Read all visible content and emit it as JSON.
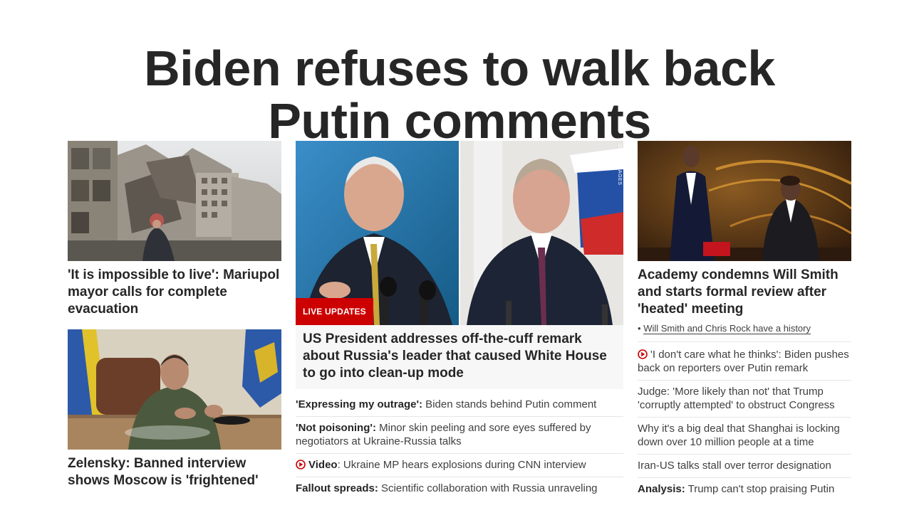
{
  "headline": {
    "line1": "Biden refuses to walk back",
    "line2": "Putin comments"
  },
  "left": {
    "story1": {
      "title": "'It is impossible to live': Mariupol mayor calls for complete evacuation"
    },
    "story2": {
      "title": "Zelensky: Banned interview shows Moscow is 'frightened'"
    }
  },
  "center": {
    "badge": "LIVE UPDATES",
    "credit": "GETTY IMAGES",
    "title": "US President addresses off-the-cuff remark about Russia's leader that caused White House to go into clean-up mode",
    "links": [
      {
        "lead": "'Expressing my outrage':",
        "text": " Biden stands behind Putin comment",
        "icon": ""
      },
      {
        "lead": "'Not poisoning':",
        "text": " Minor skin peeling and sore eyes suffered by negotiators at Ukraine-Russia talks",
        "icon": ""
      },
      {
        "lead": "Video",
        "text": ": Ukraine MP hears explosions during CNN interview",
        "icon": "play-icon"
      },
      {
        "lead": "Fallout spreads:",
        "text": " Scientific collaboration with Russia unraveling",
        "icon": ""
      }
    ]
  },
  "right": {
    "title": "Academy condemns Will Smith and starts formal review after 'heated' meeting",
    "bullet_prefix": "•",
    "bullet": "Will Smith and Chris Rock have a history",
    "links": [
      {
        "lead": "",
        "text": "'I don't care what he thinks': Biden pushes back on reporters over Putin remark",
        "icon": "play-icon"
      },
      {
        "lead": "",
        "text": "Judge: 'More likely than not' that Trump 'corruptly attempted' to obstruct Congress",
        "icon": ""
      },
      {
        "lead": "",
        "text": "Why it's a big deal that Shanghai is locking down over 10 million people at a time",
        "icon": ""
      },
      {
        "lead": "",
        "text": "Iran-US talks stall over terror designation",
        "icon": ""
      },
      {
        "lead": "Analysis:",
        "text": " Trump can't stop praising Putin",
        "icon": ""
      }
    ]
  },
  "colors": {
    "live_red": "#cc0000",
    "text": "#262626",
    "play": "#cc0000"
  }
}
